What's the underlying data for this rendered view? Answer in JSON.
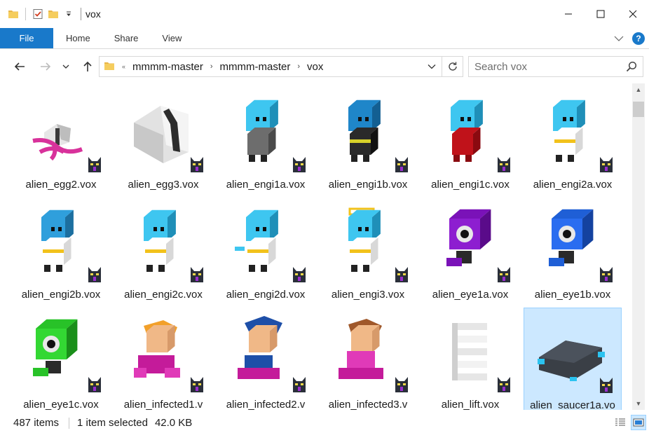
{
  "window": {
    "title": "vox",
    "controls": {
      "minimize": "minimize",
      "maximize": "maximize",
      "close": "close"
    }
  },
  "ribbon": {
    "tabs": [
      "File",
      "Home",
      "Share",
      "View"
    ]
  },
  "address": {
    "overflow": "«",
    "crumbs": [
      "mmmm-master",
      "mmmm-master",
      "vox"
    ]
  },
  "search": {
    "placeholder": "Search vox"
  },
  "files": [
    {
      "name": "alien_egg2.vox",
      "icon": "alien-egg2-thumbnail",
      "selected": false
    },
    {
      "name": "alien_egg3.vox",
      "icon": "alien-egg3-thumbnail",
      "selected": false
    },
    {
      "name": "alien_engi1a.vox",
      "icon": "alien-engi1a-thumbnail",
      "selected": false
    },
    {
      "name": "alien_engi1b.vox",
      "icon": "alien-engi1b-thumbnail",
      "selected": false
    },
    {
      "name": "alien_engi1c.vox",
      "icon": "alien-engi1c-thumbnail",
      "selected": false
    },
    {
      "name": "alien_engi2a.vox",
      "icon": "alien-engi2a-thumbnail",
      "selected": false
    },
    {
      "name": "alien_engi2b.vox",
      "icon": "alien-engi2b-thumbnail",
      "selected": false
    },
    {
      "name": "alien_engi2c.vox",
      "icon": "alien-engi2c-thumbnail",
      "selected": false
    },
    {
      "name": "alien_engi2d.vox",
      "icon": "alien-engi2d-thumbnail",
      "selected": false
    },
    {
      "name": "alien_engi3.vox",
      "icon": "alien-engi3-thumbnail",
      "selected": false
    },
    {
      "name": "alien_eye1a.vox",
      "icon": "alien-eye1a-thumbnail",
      "selected": false
    },
    {
      "name": "alien_eye1b.vox",
      "icon": "alien-eye1b-thumbnail",
      "selected": false
    },
    {
      "name": "alien_eye1c.vox",
      "icon": "alien-eye1c-thumbnail",
      "selected": false
    },
    {
      "name": "alien_infected1.v",
      "icon": "alien-infected1-thumbnail",
      "selected": false
    },
    {
      "name": "alien_infected2.v",
      "icon": "alien-infected2-thumbnail",
      "selected": false
    },
    {
      "name": "alien_infected3.v",
      "icon": "alien-infected3-thumbnail",
      "selected": false
    },
    {
      "name": "alien_lift.vox",
      "icon": "alien-lift-thumbnail",
      "selected": false
    },
    {
      "name": "alien_saucer1a.vo",
      "icon": "alien-saucer1a-thumbnail",
      "selected": true
    }
  ],
  "status": {
    "item_count": "487 items",
    "selection": "1 item selected",
    "size": "42.0 KB"
  },
  "colors": {
    "accent": "#1979ca",
    "selection_bg": "#cce8ff",
    "selection_border": "#99d1ff"
  }
}
